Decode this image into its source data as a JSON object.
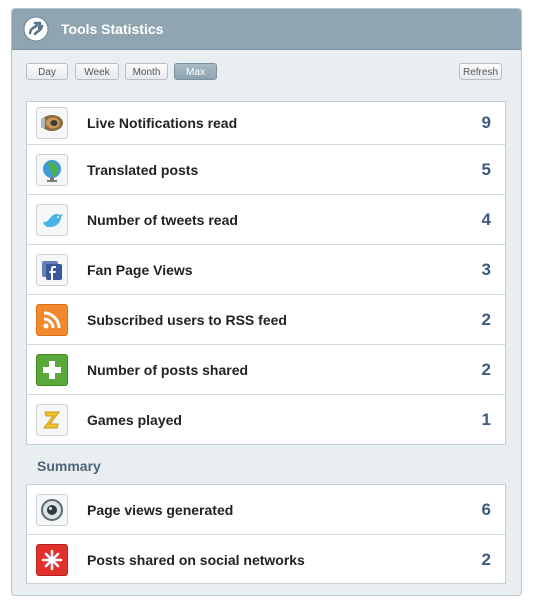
{
  "header": {
    "title": "Tools Statistics"
  },
  "toolbar": {
    "range_buttons": [
      "Day",
      "Week",
      "Month",
      "Max"
    ],
    "active_range": "Max",
    "refresh_label": "Refresh"
  },
  "stats": [
    {
      "label": "Live Notifications read",
      "value": "9",
      "icon": "speaker-icon"
    },
    {
      "label": "Translated posts",
      "value": "5",
      "icon": "globe-icon"
    },
    {
      "label": "Number of tweets read",
      "value": "4",
      "icon": "twitter-bird-icon"
    },
    {
      "label": "Fan Page Views",
      "value": "3",
      "icon": "facebook-icon"
    },
    {
      "label": "Subscribed users to RSS feed",
      "value": "2",
      "icon": "rss-icon"
    },
    {
      "label": "Number of posts shared",
      "value": "2",
      "icon": "plus-icon"
    },
    {
      "label": "Games played",
      "value": "1",
      "icon": "games-z-icon"
    }
  ],
  "summary": {
    "title": "Summary",
    "items": [
      {
        "label": "Page views generated",
        "value": "6",
        "icon": "webcam-icon"
      },
      {
        "label": "Posts shared on social networks",
        "value": "2",
        "icon": "asterisk-share-icon"
      }
    ]
  },
  "colors": {
    "header_bg": "#8fa6b2",
    "value_text": "#3c5a80",
    "panel_bg": "#e9eef1"
  }
}
